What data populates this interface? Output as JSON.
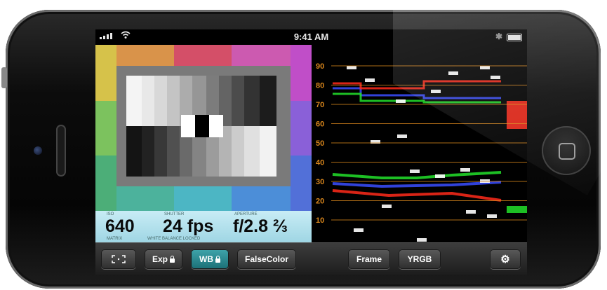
{
  "status_bar": {
    "time": "9:41 AM",
    "wifi_icon": "wifi-icon",
    "bluetooth_icon": "bluetooth-icon",
    "battery_icon": "battery-icon"
  },
  "readout": {
    "iso_label": "ISO",
    "iso_value": "640",
    "shutter_label": "SHUTTER",
    "shutter_value": "24 fps",
    "aperture_label": "APERTURE",
    "aperture_value": "f/2.8 ⅔",
    "metering_label": "MATRIX",
    "wb_label": "WHITE BALANCE LOCKED"
  },
  "waveform": {
    "scale_labels": [
      "90",
      "80",
      "70",
      "60",
      "50",
      "40",
      "30",
      "20",
      "10"
    ],
    "colors": {
      "red": "#ff2a1a",
      "green": "#22e02a",
      "blue": "#3a4dff",
      "grid": "#d9861c"
    }
  },
  "toolbar": {
    "focus_icon": "focus-brackets-icon",
    "exp_label": "Exp",
    "wb_label": "WB",
    "falsecolor_label": "FalseColor",
    "frame_label": "Frame",
    "yrgb_label": "YRGB",
    "settings_icon": "gear-icon",
    "lock_icon": "lock-icon"
  },
  "colors": {
    "accent": "#2a8f96",
    "readout_bg": "#b4e2ee"
  }
}
